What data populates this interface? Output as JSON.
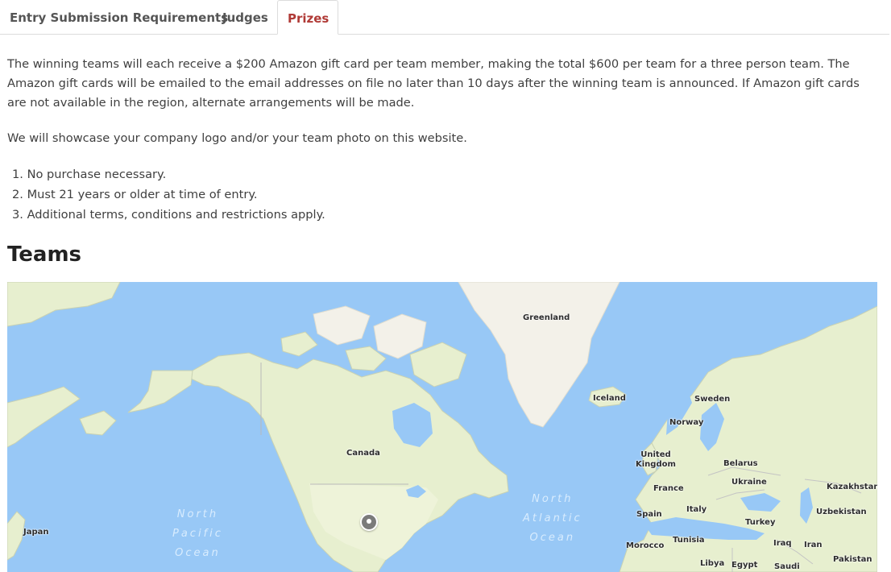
{
  "tabs": [
    {
      "label": "Entry Submission Requirements"
    },
    {
      "label": "Judges"
    },
    {
      "label": "Prizes",
      "active": true
    }
  ],
  "content": {
    "paragraph1": "The winning teams will each receive a $200 Amazon gift card per team member, making the total $600 per team for a three person team. The Amazon gift cards will be emailed to the email addresses on file no later than 10 days after the winning team is announced. If Amazon gift cards are not available in the region, alternate arrangements will be made.",
    "paragraph2": "We will showcase your company logo and/or your team photo on this website.",
    "terms": [
      "1. No purchase necessary.",
      "2. Must 21 years or older at time of entry.",
      "3. Additional terms, conditions and restrictions apply."
    ],
    "teams_heading": "Teams"
  },
  "map": {
    "country_labels": {
      "greenland": "Greenland",
      "iceland": "Iceland",
      "sweden": "Sweden",
      "norway": "Norway",
      "canada": "Canada",
      "united_kingdom": "United\nKingdom",
      "belarus": "Belarus",
      "ukraine": "Ukraine",
      "kazakhstan": "Kazakhstan",
      "france": "France",
      "italy": "Italy",
      "spain": "Spain",
      "uzbekistan": "Uzbekistan",
      "turkey": "Turkey",
      "japan": "Japan",
      "tunisia": "Tunisia",
      "morocco": "Morocco",
      "iraq": "Iraq",
      "iran": "Iran",
      "pakistan": "Pakistan",
      "libya": "Libya",
      "egypt": "Egypt",
      "saudi": "Saudi"
    },
    "ocean_labels": {
      "north_pacific": "North\nPacific\nOcean",
      "north_atlantic": "North\nAtlantic\nOcean"
    },
    "pin_icon": "map-marker-icon",
    "colors": {
      "water": "#98c8f6",
      "land": "#e7efcf",
      "ice": "#f3f1e9",
      "border": "#b9b9b9"
    }
  }
}
